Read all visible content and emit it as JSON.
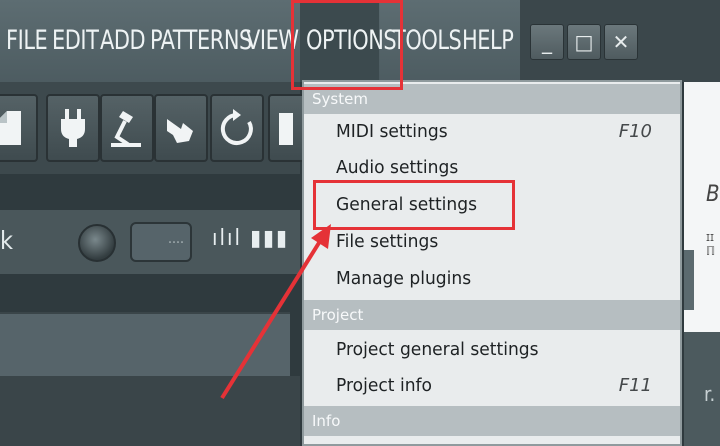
{
  "menubar": {
    "items": [
      "FILE",
      "EDIT",
      "ADD",
      "PATTERNS",
      "VIEW",
      "OPTIONS",
      "TOOLS",
      "HELP"
    ]
  },
  "window_controls": {
    "minimize": "_",
    "maximize": "□",
    "close": "✕"
  },
  "toolbar": {
    "icons": [
      "new-file-icon",
      "plug-icon",
      "desk-lamp-icon",
      "hand-pointer-icon",
      "refresh-icon",
      "save-icon"
    ]
  },
  "channel": {
    "label": "k",
    "box_text": "····",
    "icons_text": "ılıl ▮▮▮"
  },
  "right_panel": {
    "t1": "B",
    "t2": "ɪɪ\nℿ",
    "t3": "r."
  },
  "options_menu": {
    "sections": [
      {
        "header": "System",
        "items": [
          {
            "label": "MIDI settings",
            "shortcut": "F10"
          },
          {
            "label": "Audio settings",
            "shortcut": ""
          },
          {
            "label": "General settings",
            "shortcut": ""
          },
          {
            "label": "File settings",
            "shortcut": ""
          },
          {
            "label": "Manage plugins",
            "shortcut": ""
          }
        ]
      },
      {
        "header": "Project",
        "items": [
          {
            "label": "Project general settings",
            "shortcut": ""
          },
          {
            "label": "Project info",
            "shortcut": "F11"
          }
        ]
      },
      {
        "header": "Info",
        "items": []
      }
    ]
  },
  "colors": {
    "accent_red": "#e53237",
    "menu_bg": "#e9eced",
    "section_header_bg": "#b6bec1",
    "menubar_bg": "#56666b"
  }
}
